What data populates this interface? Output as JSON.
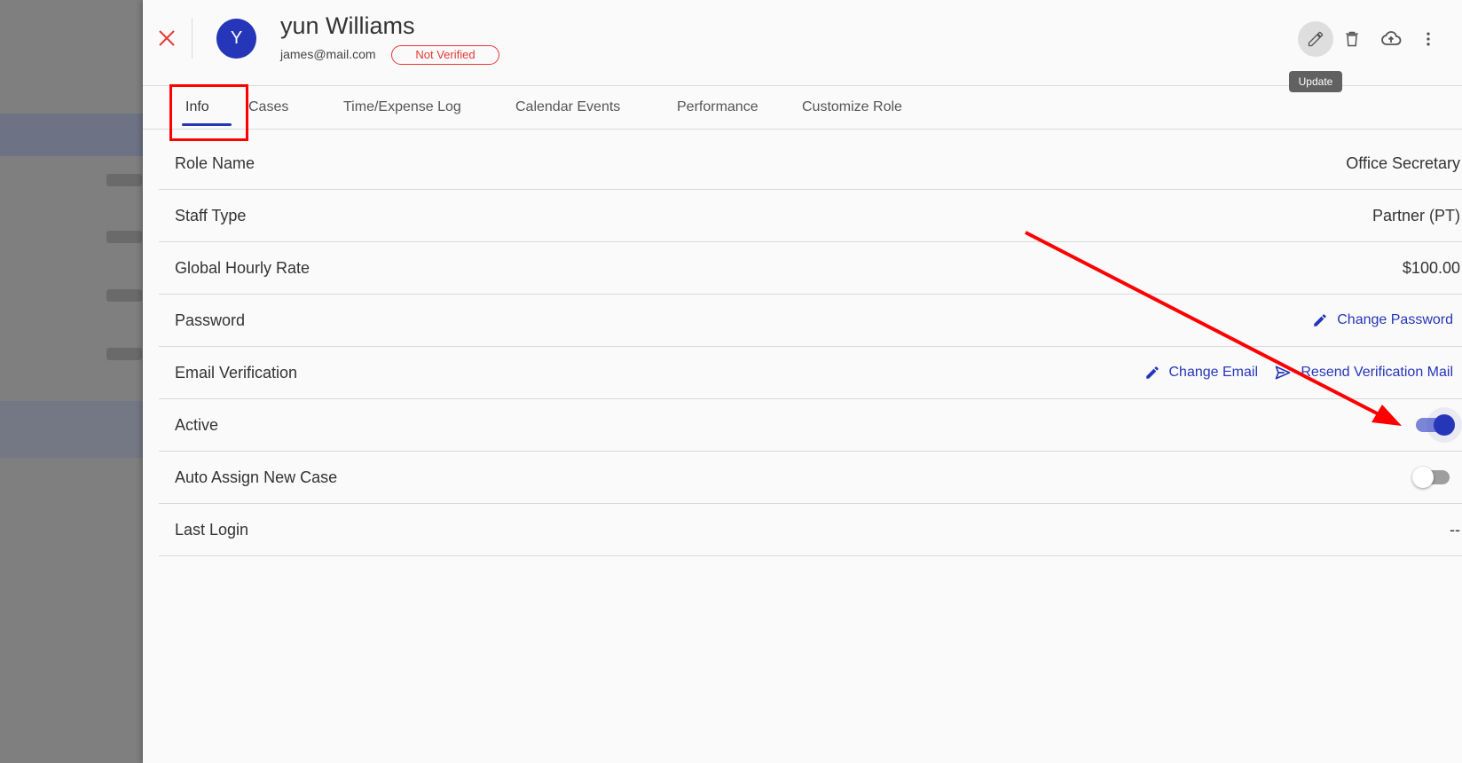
{
  "header": {
    "avatar_initial": "Y",
    "name": "yun Williams",
    "email": "james@mail.com",
    "badge": "Not Verified",
    "tooltip": "Update"
  },
  "tabs": [
    {
      "label": "Info",
      "active": true
    },
    {
      "label": "Cases"
    },
    {
      "label": "Time/Expense Log"
    },
    {
      "label": "Calendar Events"
    },
    {
      "label": "Performance"
    },
    {
      "label": "Customize Role"
    }
  ],
  "rows": {
    "role_name": {
      "label": "Role Name",
      "value": "Office Secretary"
    },
    "staff_type": {
      "label": "Staff Type",
      "value": "Partner (PT)"
    },
    "hourly_rate": {
      "label": "Global Hourly Rate",
      "value": "$100.00"
    },
    "password": {
      "label": "Password",
      "action": "Change Password"
    },
    "email_verification": {
      "label": "Email Verification",
      "action_change": "Change Email",
      "action_resend": "Resend Verification Mail"
    },
    "active": {
      "label": "Active",
      "on": true
    },
    "auto_assign": {
      "label": "Auto Assign New Case",
      "on": false
    },
    "last_login": {
      "label": "Last Login",
      "value": "--"
    }
  },
  "colors": {
    "accent": "#2536b8",
    "danger": "#e53935",
    "annotation": "#ff0000"
  },
  "icons": [
    "close-icon",
    "edit-icon",
    "trash-icon",
    "cloud-upload-icon",
    "more-vert-icon",
    "pencil-icon",
    "send-icon"
  ]
}
